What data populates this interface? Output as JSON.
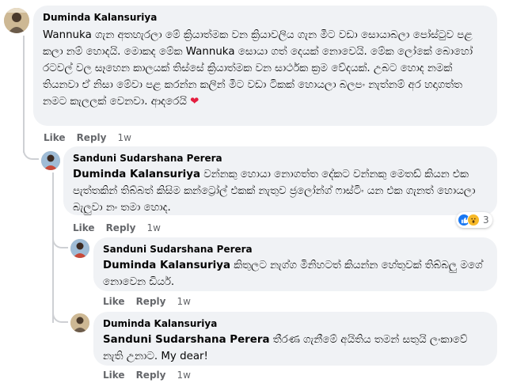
{
  "comments": [
    {
      "author": "Duminda Kalansuriya",
      "text": "Wannuka ගැන අතහැරලා මේ ක්‍රියාත්මක වන ක්‍රියාවලිය ගැන මීට වඩා සොයාබලා පෝස්ටුව පළ කලා නම් හොදයි. මොකද මේක Wannuka සොයා ගත් දෙයක් නොවෙයි. මේක ලෝකේ බොහෝ රටවල් වල සෑහෙන කාලයක් තිස්සේ ක්‍රියාත්මක වන සාර්ථක ක්‍රම වේදයක්. උබට හොද නමක් තියනවා ඒ නිසා මේවා පළ කරන්න කලින් මීට වඩා ටිකක් හොයලා බලපං නැත්නම් අර හදාගත්ත නමට කැලලක් වෙනවා. ආදරෙයි",
      "heart": "❤",
      "like": "Like",
      "reply": "Reply",
      "time": "1w"
    },
    {
      "author": "Sanduni Sudarshana Perera",
      "mention": "Duminda Kalansuriya",
      "text": " වන්නකු හොයා නොගත්ත දේකට වන්නකු මෙතඩ් කියන එක පැත්තකින් තිබ්බත් කිසිම කන්ට්‍රෝල් එකක් නැතුව ජ්‍රලෝන්ග් ෆාස්ටිං යන එක ගැනත් හොයලා බැලුවා නං තමා හොද.",
      "like": "Like",
      "reply": "Reply",
      "time": "1w",
      "reaction_count": "3"
    },
    {
      "author": "Sanduni Sudarshana Perera",
      "mention": "Duminda Kalansuriya",
      "text": " කිතුලට නැග්ග මිනිහටත් කියන්න හේතුවක් තිබ්බලු මගේ නොවෙන ඩියර්.",
      "like": "Like",
      "reply": "Reply",
      "time": "1w"
    },
    {
      "author": "Duminda Kalansuriya",
      "mention": "Sanduni Sudarshana Perera",
      "text": " තීරණ ගැනීමේ අයිතිය තමන් සතුයි ලංකාවේ නැති උනාට. My dear!",
      "like": "Like",
      "reply": "Reply",
      "time": "1w"
    }
  ]
}
